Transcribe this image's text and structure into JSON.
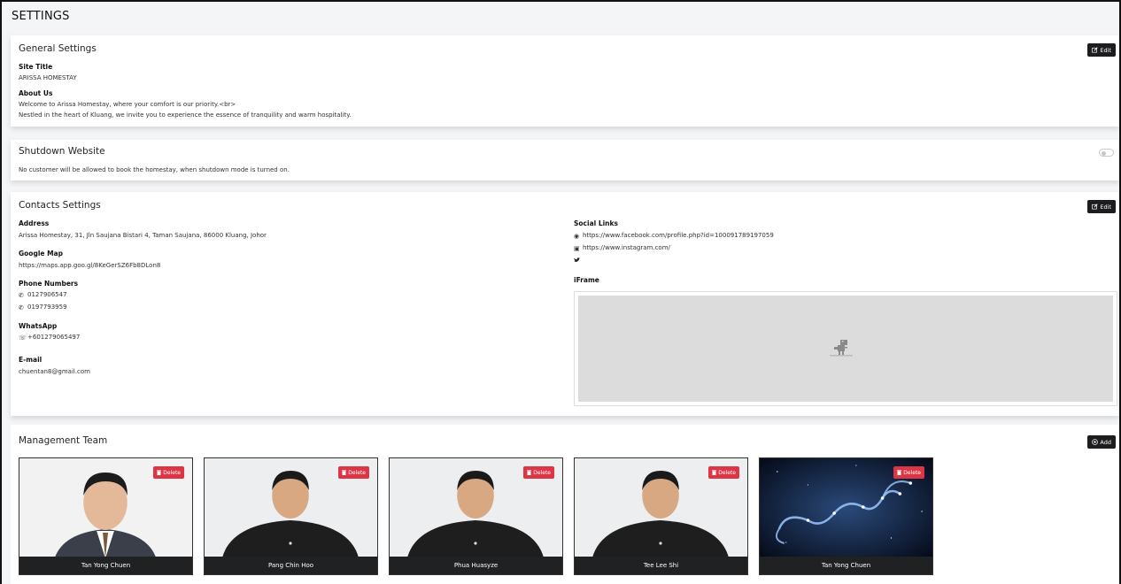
{
  "page_title": "SETTINGS",
  "general": {
    "title": "General Settings",
    "edit_label": "Edit",
    "site_title_label": "Site Title",
    "site_title_value": "ARISSA HOMESTAY",
    "about_label": "About Us",
    "about_line1": "Welcome to Arissa Homestay, where your comfort is our priority.<br>",
    "about_line2": "Nestled in the heart of Kluang, we invite you to experience the essence of tranquility and warm hospitality."
  },
  "shutdown": {
    "title": "Shutdown Website",
    "description": "No customer will be allowed to book the homestay, when shutdown mode is turned on.",
    "enabled": false
  },
  "contacts": {
    "title": "Contacts Settings",
    "edit_label": "Edit",
    "address_label": "Address",
    "address_value": "Arissa Homestay, 31, Jln Saujana Bistari 4, Taman Saujana, 86000 Kluang, Johor",
    "map_label": "Google Map",
    "map_value": "https://maps.app.goo.gl/8KeGerSZ6Fb8DLon8",
    "phone_label": "Phone Numbers",
    "phones": [
      "0127906547",
      "0197793959"
    ],
    "whatsapp_label": "WhatsApp",
    "whatsapp_value": "+601279065497",
    "email_label": "E-mail",
    "email_value": "chuentan8@gmail.com",
    "social_label": "Social Links",
    "facebook": "https://www.facebook.com/profile.php?id=100091789197059",
    "instagram": "https://www.instagram.com/",
    "twitter": "",
    "iframe_label": "iFrame"
  },
  "team": {
    "title": "Management Team",
    "add_label": "Add",
    "delete_label": "Delete",
    "members": [
      {
        "name": "Tan Yong Chuen"
      },
      {
        "name": "Pang Chin Hoo"
      },
      {
        "name": "Phua Huasyze"
      },
      {
        "name": "Tee Lee Shi"
      },
      {
        "name": "Tan Yong Chuen"
      }
    ]
  },
  "colors": {
    "dark_button": "#1d1d1f",
    "delete_button": "#dc3545",
    "page_bg": "#f4f5f7"
  }
}
